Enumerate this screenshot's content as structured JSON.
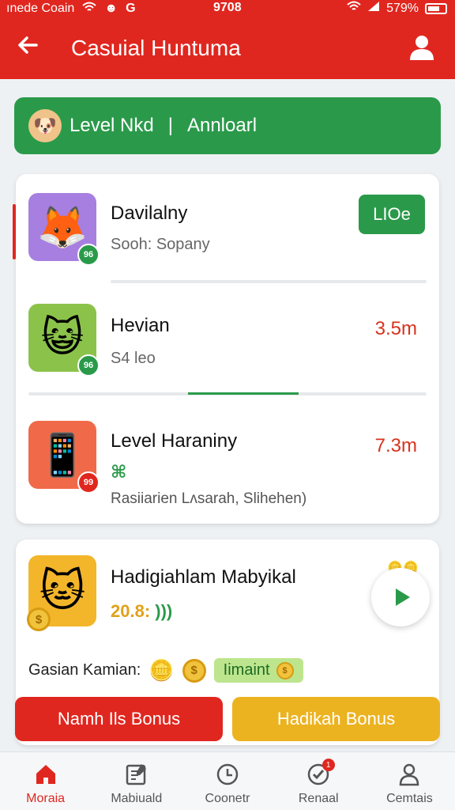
{
  "status_bar": {
    "carrier": "ınede Coain",
    "time": "9708",
    "battery": "579%"
  },
  "header": {
    "title": "Casuial Huntuma",
    "back_icon": "arrow-left-icon",
    "profile_icon": "user-icon"
  },
  "banner": {
    "level_text": "Level Nkd",
    "separator": "|",
    "right_text": "Annloarl"
  },
  "list": [
    {
      "name": "Davilalny",
      "subtitle": "Sooh: Sopany",
      "action_label": "LIOe",
      "badge": "96",
      "image": "fox"
    },
    {
      "name": "Hevian",
      "subtitle": "S4 leo",
      "price": "3.5m",
      "badge": "96",
      "image": "cat-face"
    },
    {
      "name": "Level Haraniny",
      "icon_text": "⌘",
      "subtitle": "Rasiiarien Lʌsarah, Slihehen)",
      "price": "7.3m",
      "badge": "99",
      "image": "phone"
    }
  ],
  "featured": {
    "title": "Hadigiahlam Mabyikal",
    "amount": "20.8:",
    "amount_icon": ")))",
    "label": "Gasian Kamian:",
    "pill_text": "Iimaint",
    "image": "cat-coin"
  },
  "buttons": {
    "left": "Namh Ils Bonus",
    "right": "Hadikah Bonus"
  },
  "nav": [
    {
      "label": "Moraia",
      "icon": "home-icon"
    },
    {
      "label": "Mabiuald",
      "icon": "edit-icon"
    },
    {
      "label": "Coonetr",
      "icon": "clock-icon"
    },
    {
      "label": "Renaal",
      "icon": "badge-check-icon",
      "notification": "1"
    },
    {
      "label": "Cemtais",
      "icon": "person-icon"
    }
  ],
  "colors": {
    "primary_red": "#e0271f",
    "green": "#2a9a4a",
    "yellow": "#ecb321"
  }
}
